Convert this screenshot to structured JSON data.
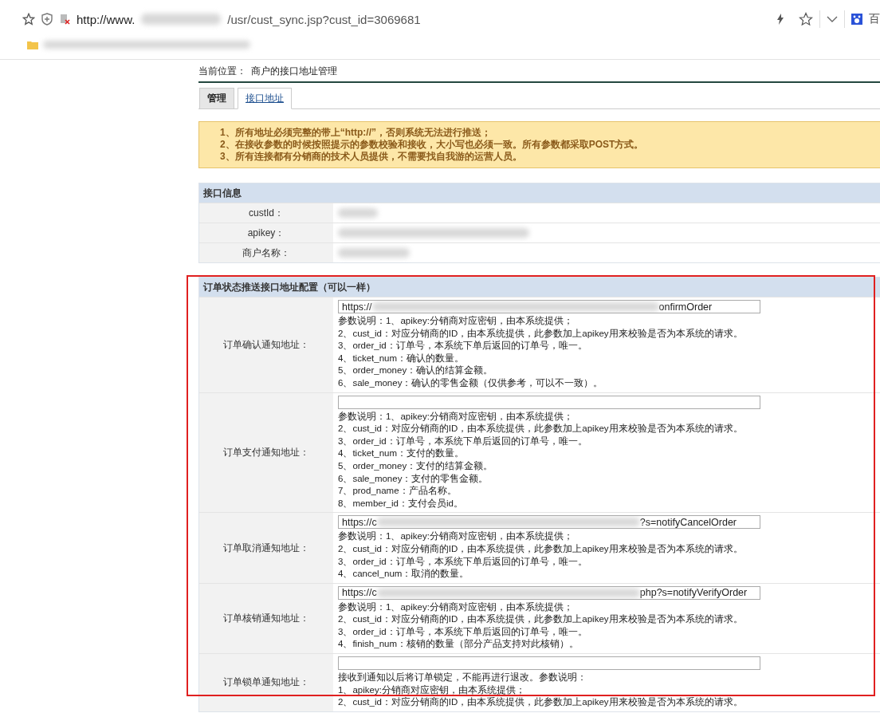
{
  "browser": {
    "url_start": "http://www.",
    "url_end": "/usr/cust_sync.jsp?cust_id=3069681",
    "search_engine_label": "百"
  },
  "breadcrumb": {
    "label": "当前位置：",
    "page": "商户的接口地址管理"
  },
  "tabs": [
    {
      "label": "管理",
      "selected": false
    },
    {
      "label": "接口地址",
      "selected": true
    }
  ],
  "notice": [
    "1、所有地址必须完整的带上“http://”，否则系统无法进行推送；",
    "2、在接收参数的时候按照提示的参数校验和接收，大小写也必须一致。所有参数都采取POST方式。",
    "3、所有连接都有分销商的技术人员提供，不需要找自我游的运营人员。"
  ],
  "info": {
    "title": "接口信息",
    "rows": [
      {
        "label": "custId："
      },
      {
        "label": "apikey："
      },
      {
        "label": "商户名称："
      }
    ]
  },
  "config": {
    "title": "订单状态推送接口地址配置（可以一样）",
    "rows": [
      {
        "label": "订单确认通知地址：",
        "url_start": "https://",
        "url_end": "onfirmOrder",
        "lines": [
          "参数说明：1、apikey:分销商对应密钥，由本系统提供；",
          "2、cust_id：对应分销商的ID，由本系统提供，此参数加上apikey用来校验是否为本系统的请求。",
          "3、order_id：订单号，本系统下单后返回的订单号，唯一。",
          "4、ticket_num：确认的数量。",
          "5、order_money：确认的结算金额。",
          "6、sale_money：确认的零售金额（仅供参考，可以不一致）。"
        ]
      },
      {
        "label": "订单支付通知地址：",
        "lines": [
          "参数说明：1、apikey:分销商对应密钥，由本系统提供；",
          "2、cust_id：对应分销商的ID，由本系统提供，此参数加上apikey用来校验是否为本系统的请求。",
          "3、order_id：订单号，本系统下单后返回的订单号，唯一。",
          "4、ticket_num：支付的数量。",
          "5、order_money：支付的结算金额。",
          "6、sale_money：支付的零售金额。",
          "7、prod_name：产品名称。",
          "8、member_id：支付会员id。"
        ]
      },
      {
        "label": "订单取消通知地址：",
        "url_start": "https://c",
        "url_end": "?s=notifyCancelOrder",
        "lines": [
          "参数说明：1、apikey:分销商对应密钥，由本系统提供；",
          "2、cust_id：对应分销商的ID，由本系统提供，此参数加上apikey用来校验是否为本系统的请求。",
          "3、order_id：订单号，本系统下单后返回的订单号，唯一。",
          "4、cancel_num：取消的数量。"
        ]
      },
      {
        "label": "订单核销通知地址：",
        "url_start": "https://c",
        "url_end": "php?s=notifyVerifyOrder",
        "lines": [
          "参数说明：1、apikey:分销商对应密钥，由本系统提供；",
          "2、cust_id：对应分销商的ID，由本系统提供，此参数加上apikey用来校验是否为本系统的请求。",
          "3、order_id：订单号，本系统下单后返回的订单号，唯一。",
          "4、finish_num：核销的数量（部分产品支持对此核销）。"
        ]
      },
      {
        "label": "订单锁单通知地址：",
        "lines": [
          "接收到通知以后将订单锁定，不能再进行退改。参数说明：",
          "1、apikey:分销商对应密钥，由本系统提供；",
          "2、cust_id：对应分销商的ID，由本系统提供，此参数加上apikey用来校验是否为本系统的请求。"
        ]
      }
    ]
  }
}
